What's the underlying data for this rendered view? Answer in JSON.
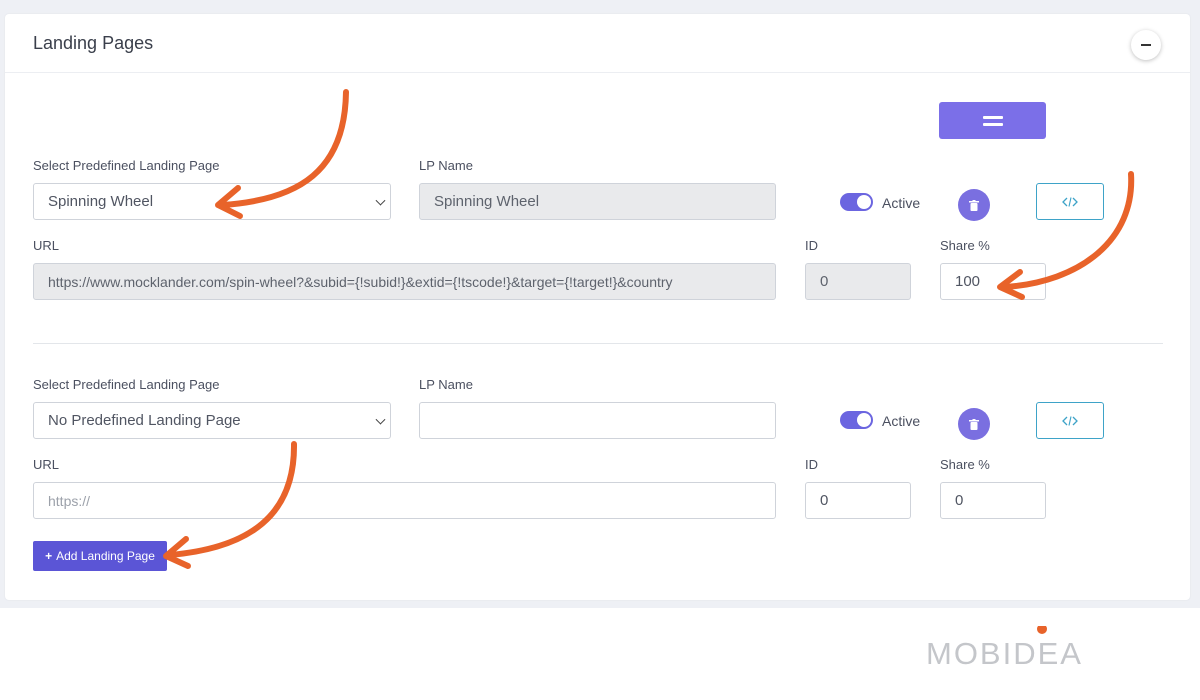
{
  "card": {
    "title": "Landing Pages",
    "collapse_icon": "minus-icon"
  },
  "reorder_icon": "drag-handle-icon",
  "landing_pages": [
    {
      "select_label": "Select Predefined Landing Page",
      "select_value": "Spinning Wheel",
      "lp_name_label": "LP Name",
      "lp_name_value": "Spinning Wheel",
      "active_label": "Active",
      "url_label": "URL",
      "url_value": "https://www.mocklander.com/spin-wheel?&subid={!subid!}&extid={!tscode!}&target={!target!}&country",
      "id_label": "ID",
      "id_value": "0",
      "share_label": "Share %",
      "share_value": "100"
    },
    {
      "select_label": "Select Predefined Landing Page",
      "select_value": "No Predefined Landing Page",
      "lp_name_label": "LP Name",
      "lp_name_value": "",
      "active_label": "Active",
      "url_label": "URL",
      "url_placeholder": "https://",
      "id_label": "ID",
      "id_value": "0",
      "share_label": "Share %",
      "share_value": "0"
    }
  ],
  "add_button": {
    "label": "Add Landing Page",
    "icon": "plus-icon"
  },
  "logo": {
    "text": "MOBIDEA",
    "accent": "#e8632a"
  },
  "colors": {
    "accent": "#7b6fe8",
    "primary_button": "#5b55d6",
    "annotation_arrow": "#e8632a",
    "code_button_border": "#3ea3c8"
  }
}
